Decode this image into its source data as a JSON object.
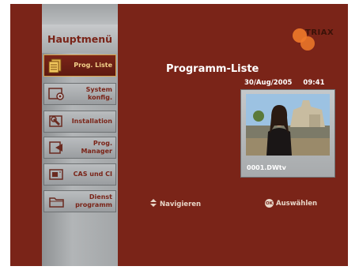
{
  "menu": {
    "title": "Hauptmenü",
    "items": [
      {
        "label": "Prog. Liste",
        "icon": "program-list-icon",
        "active": true
      },
      {
        "label": "System konfig.",
        "icon": "system-config-icon",
        "active": false
      },
      {
        "label": "Installation",
        "icon": "installation-icon",
        "active": false
      },
      {
        "label": "Prog. Manager",
        "icon": "program-manager-icon",
        "active": false
      },
      {
        "label": "CAS und CI",
        "icon": "cas-ci-icon",
        "active": false
      },
      {
        "label": "Dienst programm",
        "icon": "service-program-icon",
        "active": false
      }
    ]
  },
  "brand": {
    "name": "TRIAX"
  },
  "content": {
    "heading": "Programm-Liste",
    "date": "30/Aug/2005",
    "time": "09:41",
    "channel": "0001.DWtv"
  },
  "hints": {
    "navigate": "Navigieren",
    "select": "Auswählen",
    "ok_key": "OK"
  },
  "colors": {
    "background": "#7a2418",
    "panel": "#b2b5b7",
    "active_text": "#f4d28a",
    "brand_orange": "#f07a2a"
  }
}
